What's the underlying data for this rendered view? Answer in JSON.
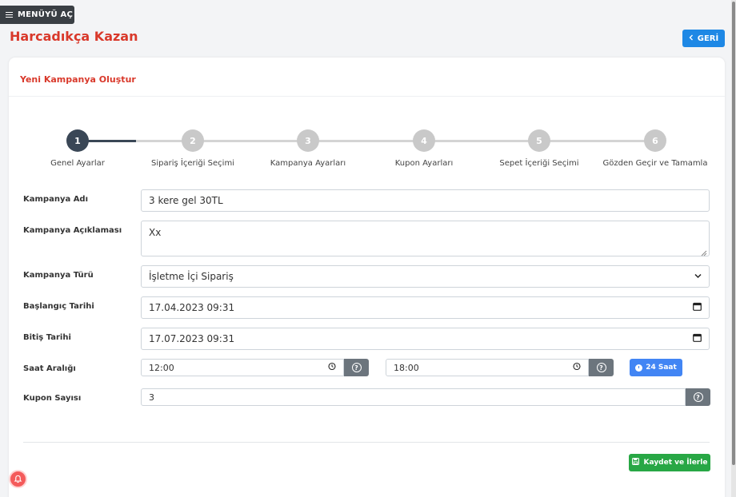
{
  "menu": {
    "label": "MENÜYÜ AÇ"
  },
  "page": {
    "title": "Harcadıkça Kazan",
    "back_label": "GERİ"
  },
  "card": {
    "title": "Yeni Kampanya Oluştur"
  },
  "steps": [
    {
      "number": "1",
      "label": "Genel Ayarlar",
      "active": true
    },
    {
      "number": "2",
      "label": "Sipariş İçeriği Seçimi",
      "active": false
    },
    {
      "number": "3",
      "label": "Kampanya Ayarları",
      "active": false
    },
    {
      "number": "4",
      "label": "Kupon Ayarları",
      "active": false
    },
    {
      "number": "5",
      "label": "Sepet İçeriği Seçimi",
      "active": false
    },
    {
      "number": "6",
      "label": "Gözden Geçir ve Tamamla",
      "active": false
    }
  ],
  "form": {
    "campaign_name": {
      "label": "Kampanya Adı",
      "value": "3 kere gel 30TL"
    },
    "campaign_description": {
      "label": "Kampanya Açıklaması",
      "value": "Xx"
    },
    "campaign_type": {
      "label": "Kampanya Türü",
      "value": "İşletme İçi Sipariş"
    },
    "start_date": {
      "label": "Başlangıç Tarihi",
      "value": "17.04.2023 09:31"
    },
    "end_date": {
      "label": "Bitiş Tarihi",
      "value": "17.07.2023 09:31"
    },
    "time_range": {
      "label": "Saat Aralığı",
      "start": "12:00",
      "end": "18:00",
      "full_day_label": "24 Saat"
    },
    "coupon_count": {
      "label": "Kupon Sayısı",
      "value": "3"
    }
  },
  "save_button": {
    "label": "Kaydet ve İlerle"
  },
  "colors": {
    "brand_red": "#d9392b",
    "primary_blue": "#1e88e5",
    "success_green": "#28a745",
    "step_active": "#3a4756",
    "step_inactive": "#c9c9c9"
  }
}
